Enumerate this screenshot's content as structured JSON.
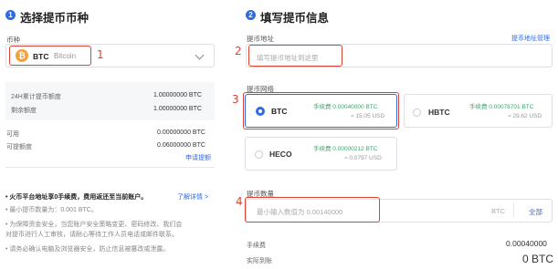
{
  "left": {
    "step1_badge": "1",
    "step1_title": "选择提币币种",
    "currency_label": "币种",
    "coin_icon_text": "₿",
    "coin_code": "BTC",
    "coin_name": "Bitcoin",
    "anno_1": "1",
    "limit_rows": [
      {
        "label": "24H累计提币额度",
        "value": "1.00000000 BTC"
      },
      {
        "label": "剩余额度",
        "value": "1.00000000 BTC"
      }
    ],
    "avail_rows": [
      {
        "label": "可用",
        "value": "0.00000000 BTC"
      },
      {
        "label": "可提额度",
        "value": "0.06000000 BTC"
      }
    ],
    "apply_link": "申请提额",
    "notice_title": "• 火币平台地址享0手续费，费用返还至当前账户。",
    "notice_link": "了解详情 >",
    "notes": [
      "• 最小提币数量为：0.001 BTC。",
      "• 为保障资金安全，当您账户安全策略变更、密码修改、我们会",
      "对提币进行人工审核，请耐心等待工作人员电话或邮件联系。",
      "• 请务必确认电脑及浏览器安全，防止信息被篡改或泄露。"
    ]
  },
  "right": {
    "step2_badge": "2",
    "step2_title": "填写提币信息",
    "address_label": "提币地址",
    "address_manage_link": "提币地址管理",
    "address_placeholder": "填写提币地址到这里",
    "anno_2": "2",
    "network_label": "提币网络",
    "anno_3": "3",
    "networks": [
      {
        "name": "BTC",
        "fee": "手续费 0.00040000 BTC",
        "fee_usd": "≈ 15.05 USD"
      },
      {
        "name": "HBTC",
        "fee": "手续费 0.00078701 BTC",
        "fee_usd": "≈ 29.62 USD"
      },
      {
        "name": "HECO",
        "fee": "手续费 0.00000212 BTC",
        "fee_usd": "≈ 0.0797 USD"
      }
    ],
    "amount_label": "提币数量",
    "anno_4": "4",
    "amount_placeholder": "最小输入数值为 0.00140000",
    "amount_unit": "BTC",
    "amount_all": "全部",
    "fee_label": "手续费",
    "fee_value": "0.00040000",
    "received_label": "实际到账",
    "received_value": "0 BTC"
  },
  "colors": {
    "accent": "#2f6be0",
    "annotation": "#d9432f",
    "fee_green": "#3aa86b"
  }
}
